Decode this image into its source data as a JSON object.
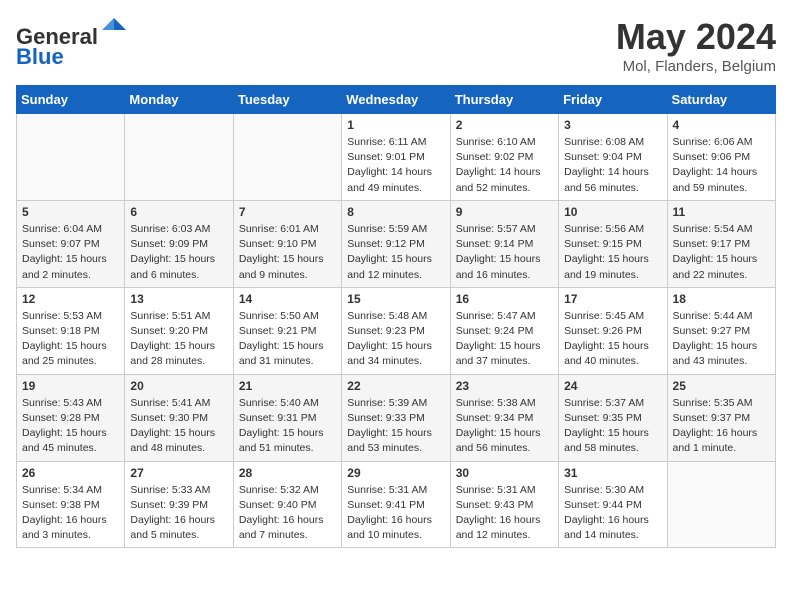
{
  "header": {
    "logo_general": "General",
    "logo_blue": "Blue",
    "month": "May 2024",
    "location": "Mol, Flanders, Belgium"
  },
  "weekdays": [
    "Sunday",
    "Monday",
    "Tuesday",
    "Wednesday",
    "Thursday",
    "Friday",
    "Saturday"
  ],
  "weeks": [
    [
      {
        "day": "",
        "content": ""
      },
      {
        "day": "",
        "content": ""
      },
      {
        "day": "",
        "content": ""
      },
      {
        "day": "1",
        "content": "Sunrise: 6:11 AM\nSunset: 9:01 PM\nDaylight: 14 hours\nand 49 minutes."
      },
      {
        "day": "2",
        "content": "Sunrise: 6:10 AM\nSunset: 9:02 PM\nDaylight: 14 hours\nand 52 minutes."
      },
      {
        "day": "3",
        "content": "Sunrise: 6:08 AM\nSunset: 9:04 PM\nDaylight: 14 hours\nand 56 minutes."
      },
      {
        "day": "4",
        "content": "Sunrise: 6:06 AM\nSunset: 9:06 PM\nDaylight: 14 hours\nand 59 minutes."
      }
    ],
    [
      {
        "day": "5",
        "content": "Sunrise: 6:04 AM\nSunset: 9:07 PM\nDaylight: 15 hours\nand 2 minutes."
      },
      {
        "day": "6",
        "content": "Sunrise: 6:03 AM\nSunset: 9:09 PM\nDaylight: 15 hours\nand 6 minutes."
      },
      {
        "day": "7",
        "content": "Sunrise: 6:01 AM\nSunset: 9:10 PM\nDaylight: 15 hours\nand 9 minutes."
      },
      {
        "day": "8",
        "content": "Sunrise: 5:59 AM\nSunset: 9:12 PM\nDaylight: 15 hours\nand 12 minutes."
      },
      {
        "day": "9",
        "content": "Sunrise: 5:57 AM\nSunset: 9:14 PM\nDaylight: 15 hours\nand 16 minutes."
      },
      {
        "day": "10",
        "content": "Sunrise: 5:56 AM\nSunset: 9:15 PM\nDaylight: 15 hours\nand 19 minutes."
      },
      {
        "day": "11",
        "content": "Sunrise: 5:54 AM\nSunset: 9:17 PM\nDaylight: 15 hours\nand 22 minutes."
      }
    ],
    [
      {
        "day": "12",
        "content": "Sunrise: 5:53 AM\nSunset: 9:18 PM\nDaylight: 15 hours\nand 25 minutes."
      },
      {
        "day": "13",
        "content": "Sunrise: 5:51 AM\nSunset: 9:20 PM\nDaylight: 15 hours\nand 28 minutes."
      },
      {
        "day": "14",
        "content": "Sunrise: 5:50 AM\nSunset: 9:21 PM\nDaylight: 15 hours\nand 31 minutes."
      },
      {
        "day": "15",
        "content": "Sunrise: 5:48 AM\nSunset: 9:23 PM\nDaylight: 15 hours\nand 34 minutes."
      },
      {
        "day": "16",
        "content": "Sunrise: 5:47 AM\nSunset: 9:24 PM\nDaylight: 15 hours\nand 37 minutes."
      },
      {
        "day": "17",
        "content": "Sunrise: 5:45 AM\nSunset: 9:26 PM\nDaylight: 15 hours\nand 40 minutes."
      },
      {
        "day": "18",
        "content": "Sunrise: 5:44 AM\nSunset: 9:27 PM\nDaylight: 15 hours\nand 43 minutes."
      }
    ],
    [
      {
        "day": "19",
        "content": "Sunrise: 5:43 AM\nSunset: 9:28 PM\nDaylight: 15 hours\nand 45 minutes."
      },
      {
        "day": "20",
        "content": "Sunrise: 5:41 AM\nSunset: 9:30 PM\nDaylight: 15 hours\nand 48 minutes."
      },
      {
        "day": "21",
        "content": "Sunrise: 5:40 AM\nSunset: 9:31 PM\nDaylight: 15 hours\nand 51 minutes."
      },
      {
        "day": "22",
        "content": "Sunrise: 5:39 AM\nSunset: 9:33 PM\nDaylight: 15 hours\nand 53 minutes."
      },
      {
        "day": "23",
        "content": "Sunrise: 5:38 AM\nSunset: 9:34 PM\nDaylight: 15 hours\nand 56 minutes."
      },
      {
        "day": "24",
        "content": "Sunrise: 5:37 AM\nSunset: 9:35 PM\nDaylight: 15 hours\nand 58 minutes."
      },
      {
        "day": "25",
        "content": "Sunrise: 5:35 AM\nSunset: 9:37 PM\nDaylight: 16 hours\nand 1 minute."
      }
    ],
    [
      {
        "day": "26",
        "content": "Sunrise: 5:34 AM\nSunset: 9:38 PM\nDaylight: 16 hours\nand 3 minutes."
      },
      {
        "day": "27",
        "content": "Sunrise: 5:33 AM\nSunset: 9:39 PM\nDaylight: 16 hours\nand 5 minutes."
      },
      {
        "day": "28",
        "content": "Sunrise: 5:32 AM\nSunset: 9:40 PM\nDaylight: 16 hours\nand 7 minutes."
      },
      {
        "day": "29",
        "content": "Sunrise: 5:31 AM\nSunset: 9:41 PM\nDaylight: 16 hours\nand 10 minutes."
      },
      {
        "day": "30",
        "content": "Sunrise: 5:31 AM\nSunset: 9:43 PM\nDaylight: 16 hours\nand 12 minutes."
      },
      {
        "day": "31",
        "content": "Sunrise: 5:30 AM\nSunset: 9:44 PM\nDaylight: 16 hours\nand 14 minutes."
      },
      {
        "day": "",
        "content": ""
      }
    ]
  ]
}
